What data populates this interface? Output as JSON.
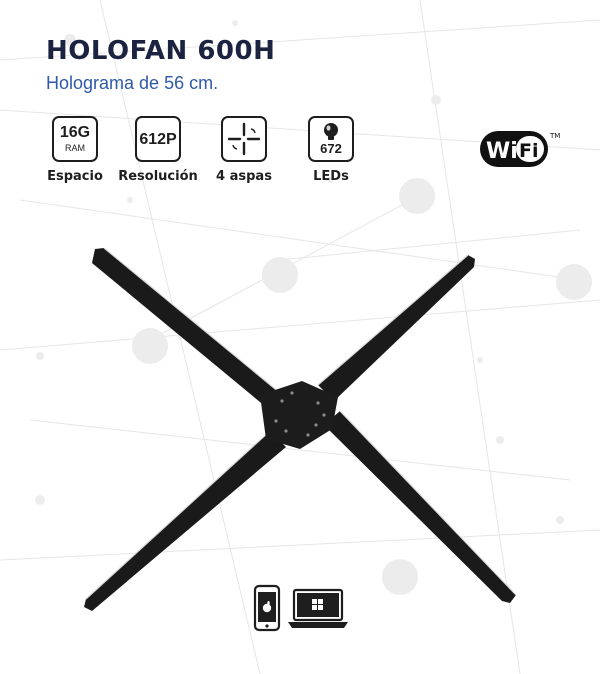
{
  "product": {
    "title": "HOLOFAN 600H",
    "subtitle": "Holograma de 56 cm."
  },
  "specs": [
    {
      "value": "16G",
      "unit": "RAM",
      "label": "Espacio",
      "icon": "memory-icon"
    },
    {
      "value": "612P",
      "unit": "",
      "label": "Resolución",
      "icon": "resolution-icon"
    },
    {
      "value": "",
      "unit": "",
      "label": "4 aspas",
      "icon": "fan-blades-icon"
    },
    {
      "value": "672",
      "unit": "",
      "label": "LEDs",
      "icon": "led-bulb-icon"
    }
  ],
  "wifi": {
    "text_wi": "Wi",
    "text_fi": "Fi",
    "trademark": "TM"
  },
  "compat_icons": [
    "apple-phone-icon",
    "windows-laptop-icon"
  ],
  "colors": {
    "title": "#1b2340",
    "subtitle": "#2e5aa8",
    "icon_stroke": "#1e1e1e",
    "blade": "#1a1a1a"
  }
}
